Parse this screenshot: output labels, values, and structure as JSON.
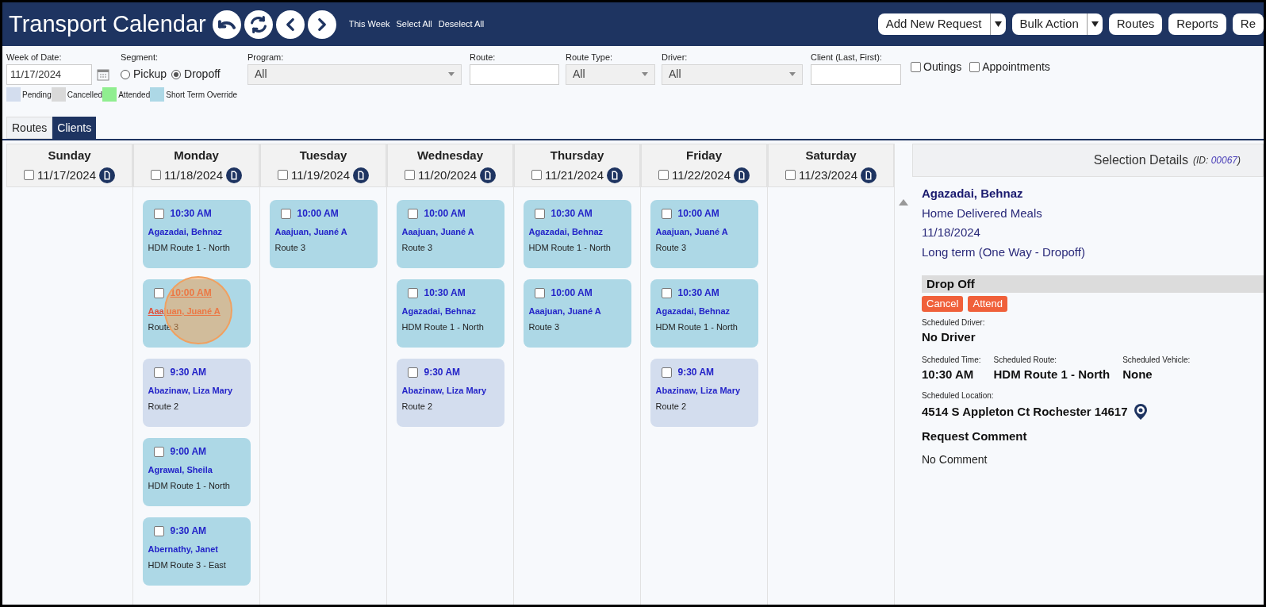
{
  "header": {
    "title": "Transport Calendar",
    "links": [
      "This Week",
      "Select All",
      "Deselect All"
    ],
    "actions": [
      {
        "label": "Add New Request",
        "kind": "split"
      },
      {
        "label": "Bulk Action",
        "kind": "split"
      },
      {
        "label": "Routes",
        "kind": "plain"
      },
      {
        "label": "Reports",
        "kind": "plain"
      },
      {
        "label": "Re",
        "kind": "plain"
      }
    ]
  },
  "filters": {
    "week_of_date": {
      "label": "Week of Date:",
      "value": "11/17/2024"
    },
    "segment": {
      "label": "Segment:",
      "options": [
        {
          "label": "Pickup",
          "selected": false
        },
        {
          "label": "Dropoff",
          "selected": true
        }
      ]
    },
    "program": {
      "label": "Program:",
      "value": "All"
    },
    "route": {
      "label": "Route:"
    },
    "route_type": {
      "label": "Route Type:",
      "value": "All"
    },
    "driver": {
      "label": "Driver:",
      "value": "All"
    },
    "client": {
      "label": "Client (Last, First):"
    },
    "toggles": [
      {
        "label": "Outings",
        "checked": false
      },
      {
        "label": "Appointments",
        "checked": false
      }
    ]
  },
  "legend": [
    {
      "label": "Pending",
      "color": "#d3ddee"
    },
    {
      "label": "Cancelled",
      "color": "#d9d9d9"
    },
    {
      "label": "Attended",
      "color": "#90ee90"
    },
    {
      "label": "Short Term Override",
      "color": "#add8e6"
    }
  ],
  "tabs": [
    {
      "label": "Routes",
      "selected": false
    },
    {
      "label": "Clients",
      "selected": true
    }
  ],
  "days": [
    {
      "name": "Sunday",
      "date": "11/17/2024",
      "checked": false
    },
    {
      "name": "Monday",
      "date": "11/18/2024",
      "checked": false,
      "cards": [
        {
          "time": "10:30 AM",
          "client": "Agazadai, Behnaz",
          "route": "HDM Route 1 - North",
          "color": "#add8e6",
          "checked": false,
          "hovered": false
        },
        {
          "time": "10:00 AM",
          "client": "Aaajuan, Juané A",
          "route": "Route 3",
          "color": "#add8e6",
          "checked": false,
          "hovered": true
        },
        {
          "time": "9:30 AM",
          "client": "Abazinaw, Liza Mary",
          "route": "Route 2",
          "color": "#d3ddee",
          "checked": false,
          "hovered": false
        },
        {
          "time": "9:00 AM",
          "client": "Agrawal, Sheila",
          "route": "HDM Route 1 - North",
          "color": "#add8e6",
          "checked": false,
          "hovered": false
        },
        {
          "time": "9:30 AM",
          "client": "Abernathy, Janet",
          "route": "HDM Route 3 - East",
          "color": "#add8e6",
          "checked": false,
          "hovered": false
        }
      ]
    },
    {
      "name": "Tuesday",
      "date": "11/19/2024",
      "checked": false,
      "cards": [
        {
          "time": "10:00 AM",
          "client": "Aaajuan, Juané A",
          "route": "Route 3",
          "color": "#add8e6",
          "checked": false,
          "hovered": false
        }
      ]
    },
    {
      "name": "Wednesday",
      "date": "11/20/2024",
      "checked": false,
      "cards": [
        {
          "time": "10:00 AM",
          "client": "Aaajuan, Juané A",
          "route": "Route 3",
          "color": "#add8e6",
          "checked": false,
          "hovered": false
        },
        {
          "time": "10:30 AM",
          "client": "Agazadai, Behnaz",
          "route": "HDM Route 1 - North",
          "color": "#add8e6",
          "checked": false,
          "hovered": false
        },
        {
          "time": "9:30 AM",
          "client": "Abazinaw, Liza Mary",
          "route": "Route 2",
          "color": "#d3ddee",
          "checked": false,
          "hovered": false
        }
      ]
    },
    {
      "name": "Thursday",
      "date": "11/21/2024",
      "checked": false,
      "cards": [
        {
          "time": "10:30 AM",
          "client": "Agazadai, Behnaz",
          "route": "HDM Route 1 - North",
          "color": "#add8e6",
          "checked": false,
          "hovered": false
        },
        {
          "time": "10:00 AM",
          "client": "Aaajuan, Juané A",
          "route": "Route 3",
          "color": "#add8e6",
          "checked": false,
          "hovered": false
        }
      ]
    },
    {
      "name": "Friday",
      "date": "11/22/2024",
      "checked": false,
      "cards": [
        {
          "time": "10:00 AM",
          "client": "Aaajuan, Juané A",
          "route": "Route 3",
          "color": "#add8e6",
          "checked": false,
          "hovered": false
        },
        {
          "time": "10:30 AM",
          "client": "Agazadai, Behnaz",
          "route": "HDM Route 1 - North",
          "color": "#add8e6",
          "checked": false,
          "hovered": false
        },
        {
          "time": "9:30 AM",
          "client": "Abazinaw, Liza Mary",
          "route": "Route 2",
          "color": "#d3ddee",
          "checked": false,
          "hovered": false
        }
      ]
    },
    {
      "name": "Saturday",
      "date": "11/23/2024",
      "checked": false
    }
  ],
  "details": {
    "title": "Selection Details",
    "id_label": "(ID:",
    "id": "00067",
    "id_close": ")",
    "client": "Agazadai, Behnaz",
    "program": "Home Delivered Meals",
    "date": "11/18/2024",
    "term": "Long term (One Way - Dropoff)",
    "section": "Drop Off",
    "buttons": [
      "Cancel",
      "Attend"
    ],
    "driver": {
      "label": "Scheduled Driver:",
      "value": "No Driver"
    },
    "fields": [
      {
        "label": "Scheduled Time:",
        "value": "10:30 AM"
      },
      {
        "label": "Scheduled Route:",
        "value": "HDM Route 1 - North"
      },
      {
        "label": "Scheduled Vehicle:",
        "value": "None"
      }
    ],
    "location": {
      "label": "Scheduled Location:",
      "value": "4514 S Appleton Ct Rochester 14617"
    },
    "comment_heading": "Request Comment",
    "comment": "No Comment"
  }
}
